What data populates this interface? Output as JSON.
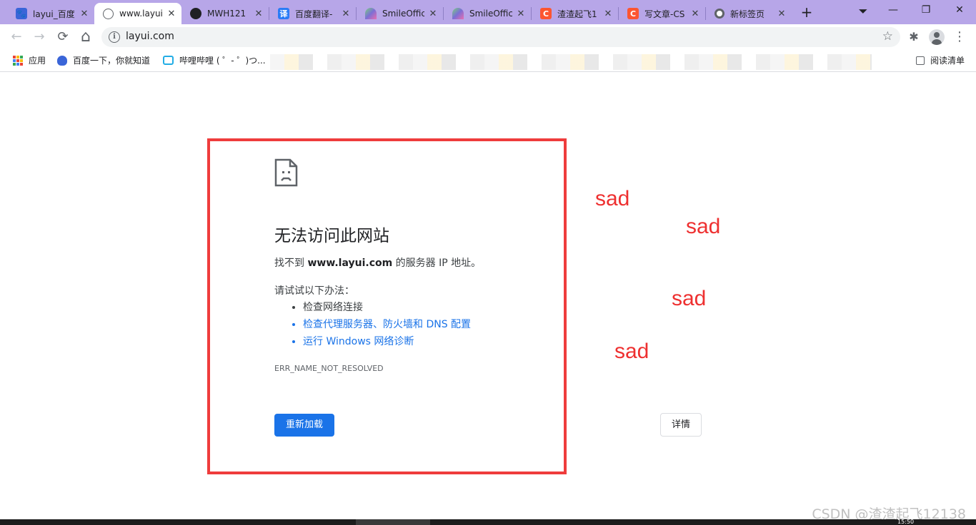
{
  "browser": {
    "tabs": [
      {
        "title": "layui_百度",
        "favicon": "baidu-paw-icon",
        "color": "#3a65d8"
      },
      {
        "title": "www.layui",
        "favicon": "globe-icon",
        "color": "#5f6368",
        "active": true
      },
      {
        "title": "MWH121",
        "favicon": "github-icon",
        "color": "#202124"
      },
      {
        "title": "百度翻译-",
        "favicon": "translate-icon",
        "color": "#2a7cf6"
      },
      {
        "title": "SmileOffic",
        "favicon": "smileoffice-icon",
        "color": "#7b6fd6"
      },
      {
        "title": "SmileOffic",
        "favicon": "smileoffice-icon",
        "color": "#7b6fd6"
      },
      {
        "title": "渣渣起飞1",
        "favicon": "csdn-icon",
        "color": "#fc5531"
      },
      {
        "title": "写文章-CS",
        "favicon": "csdn-icon",
        "color": "#fc5531"
      },
      {
        "title": "新标签页",
        "favicon": "chrome-icon",
        "color": "#5f6368"
      }
    ],
    "new_tab_symbol": "+",
    "window_controls": {
      "menu": "⏷",
      "minimize": "—",
      "restore": "❐",
      "close": "✕"
    },
    "toolbar": {
      "back": "←",
      "forward": "→",
      "reload": "⟳",
      "home": "⌂",
      "url": "layui.com",
      "extensions": "✱",
      "menu": "⋮"
    },
    "bookmarks": [
      {
        "label": "应用",
        "icon": "apps-grid-icon"
      },
      {
        "label": "百度一下，你就知道",
        "icon": "baidu-paw-icon"
      },
      {
        "label": "哔哩哔哩 ( ゜- ゜)つ...",
        "icon": "bilibili-icon"
      }
    ],
    "reading_list": "阅读清单"
  },
  "error_page": {
    "title": "无法访问此网站",
    "desc_prefix": "找不到 ",
    "desc_host": "www.layui.com",
    "desc_suffix": " 的服务器 IP 地址。",
    "try_label": "请试试以下办法：",
    "suggestions": [
      "检查网络连接",
      "检查代理服务器、防火墙和 DNS 配置",
      "运行 Windows 网络诊断"
    ],
    "error_code": "ERR_NAME_NOT_RESOLVED",
    "reload_button": "重新加载",
    "details_button": "详情"
  },
  "annotations": {
    "sad_words": [
      "sad",
      "sad",
      "sad",
      "sad"
    ],
    "highlight_color": "#ef3c3c"
  },
  "watermark": "CSDN @渣渣起飞12138",
  "taskbar_clock": "15:50"
}
